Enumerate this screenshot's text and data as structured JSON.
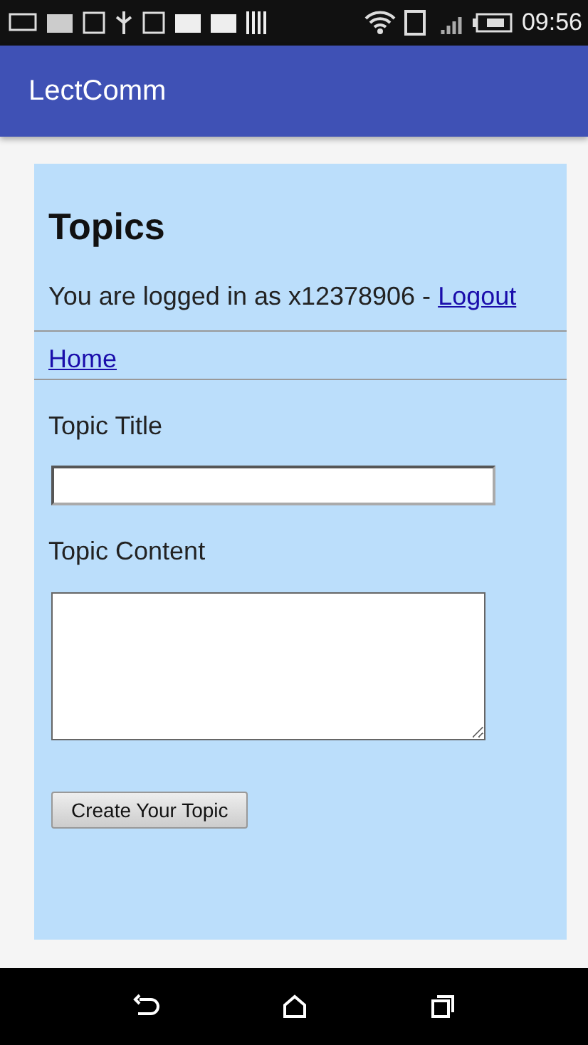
{
  "status_bar": {
    "time": "09:56"
  },
  "app_bar": {
    "title": "LectComm"
  },
  "page": {
    "heading": "Topics",
    "login_text": "You are logged in as x12378906 - ",
    "logout_link": "Logout",
    "nav_link": "Home",
    "fields": [
      {
        "kind": "input",
        "label": "Topic Title"
      },
      {
        "kind": "textarea",
        "label": "Topic Content"
      }
    ],
    "submit_button": "Create Your Topic"
  }
}
